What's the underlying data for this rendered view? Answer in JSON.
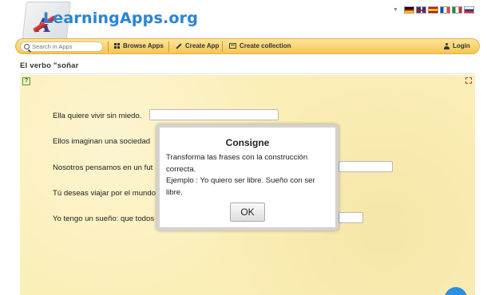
{
  "header": {
    "logo_text": "LearningApps.org",
    "logo_letter": "A",
    "language_flags": [
      "de",
      "gb",
      "es",
      "fr",
      "it",
      "ru"
    ]
  },
  "toolbar": {
    "search_placeholder": "Search in Apps",
    "browse_apps": "Browse Apps",
    "create_app": "Create App",
    "create_collection": "Create collection",
    "login": "Login"
  },
  "app": {
    "title": "El verbo \"soñar",
    "sentences": [
      {
        "text": "Ella quiere vivir sin miedo.",
        "answer": ""
      },
      {
        "text": "Ellos imaginan una sociedad",
        "answer": ""
      },
      {
        "text": "Nosotros pensamos en un fut",
        "answer": ""
      },
      {
        "text": "Tú deseas viajar por el mundo",
        "answer": ""
      },
      {
        "text": "Yo tengo un sueño: que todos",
        "answer": ""
      }
    ]
  },
  "dialog": {
    "title": "Consigne",
    "line1": "Transforma las frases con la construcción correcta.",
    "line2": "Ejemplo : Yo quiero ser libre. Sueño con ser libre.",
    "ok_label": "OK"
  },
  "colors": {
    "toolbar": "#f6c552",
    "app_background": "#fbefb8",
    "logo_text": "#2a84d4",
    "fab": "#2b8fe3"
  }
}
